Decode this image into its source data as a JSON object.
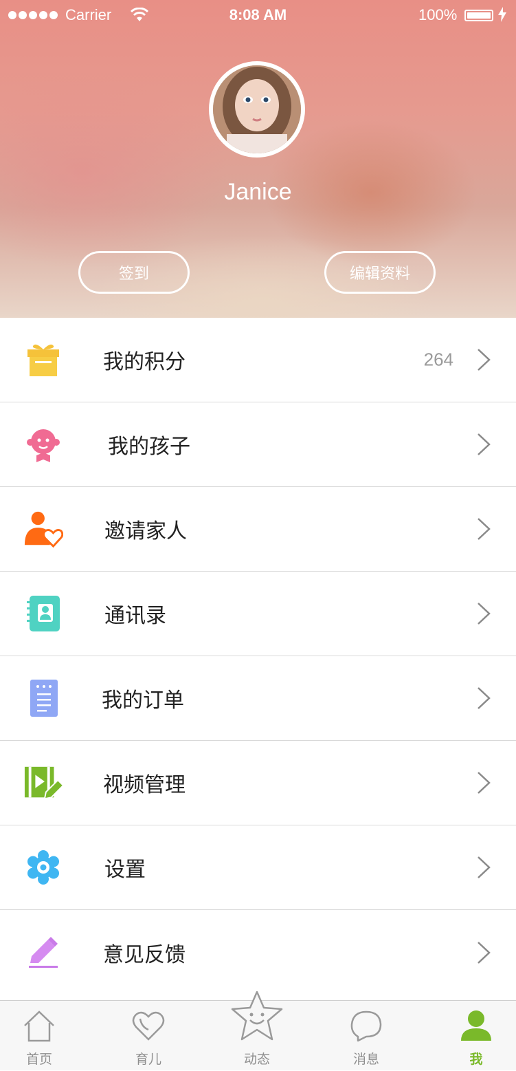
{
  "status_bar": {
    "carrier": "Carrier",
    "time": "8:08 AM",
    "battery": "100%"
  },
  "profile": {
    "name": "Janice",
    "checkin_label": "签到",
    "edit_label": "编辑资料"
  },
  "menu": [
    {
      "label": "我的积分",
      "value": "264",
      "icon": "gift-icon",
      "color": "#f5c23a"
    },
    {
      "label": "我的孩子",
      "icon": "baby-icon",
      "color": "#f06b93"
    },
    {
      "label": "邀请家人",
      "icon": "invite-family-icon",
      "color": "#ff6a13"
    },
    {
      "label": "通讯录",
      "icon": "contacts-icon",
      "color": "#4fd2c2"
    },
    {
      "label": "我的订单",
      "icon": "orders-icon",
      "color": "#8fa7f5"
    },
    {
      "label": "视频管理",
      "icon": "video-manage-icon",
      "color": "#7ab92a"
    },
    {
      "label": "设置",
      "icon": "settings-icon",
      "color": "#3fb6f2"
    },
    {
      "label": "意见反馈",
      "icon": "feedback-icon",
      "color": "#c97be8"
    }
  ],
  "tabbar": [
    {
      "label": "首页",
      "icon": "home-icon",
      "active": false
    },
    {
      "label": "育儿",
      "icon": "parenting-heart-icon",
      "active": false
    },
    {
      "label": "动态",
      "icon": "star-face-icon",
      "active": false
    },
    {
      "label": "消息",
      "icon": "message-icon",
      "active": false
    },
    {
      "label": "我",
      "icon": "person-icon",
      "active": true
    }
  ],
  "colors": {
    "accent": "#7ab92a",
    "divider": "#d9d9d9",
    "tab_inactive": "#8f8f8f"
  }
}
